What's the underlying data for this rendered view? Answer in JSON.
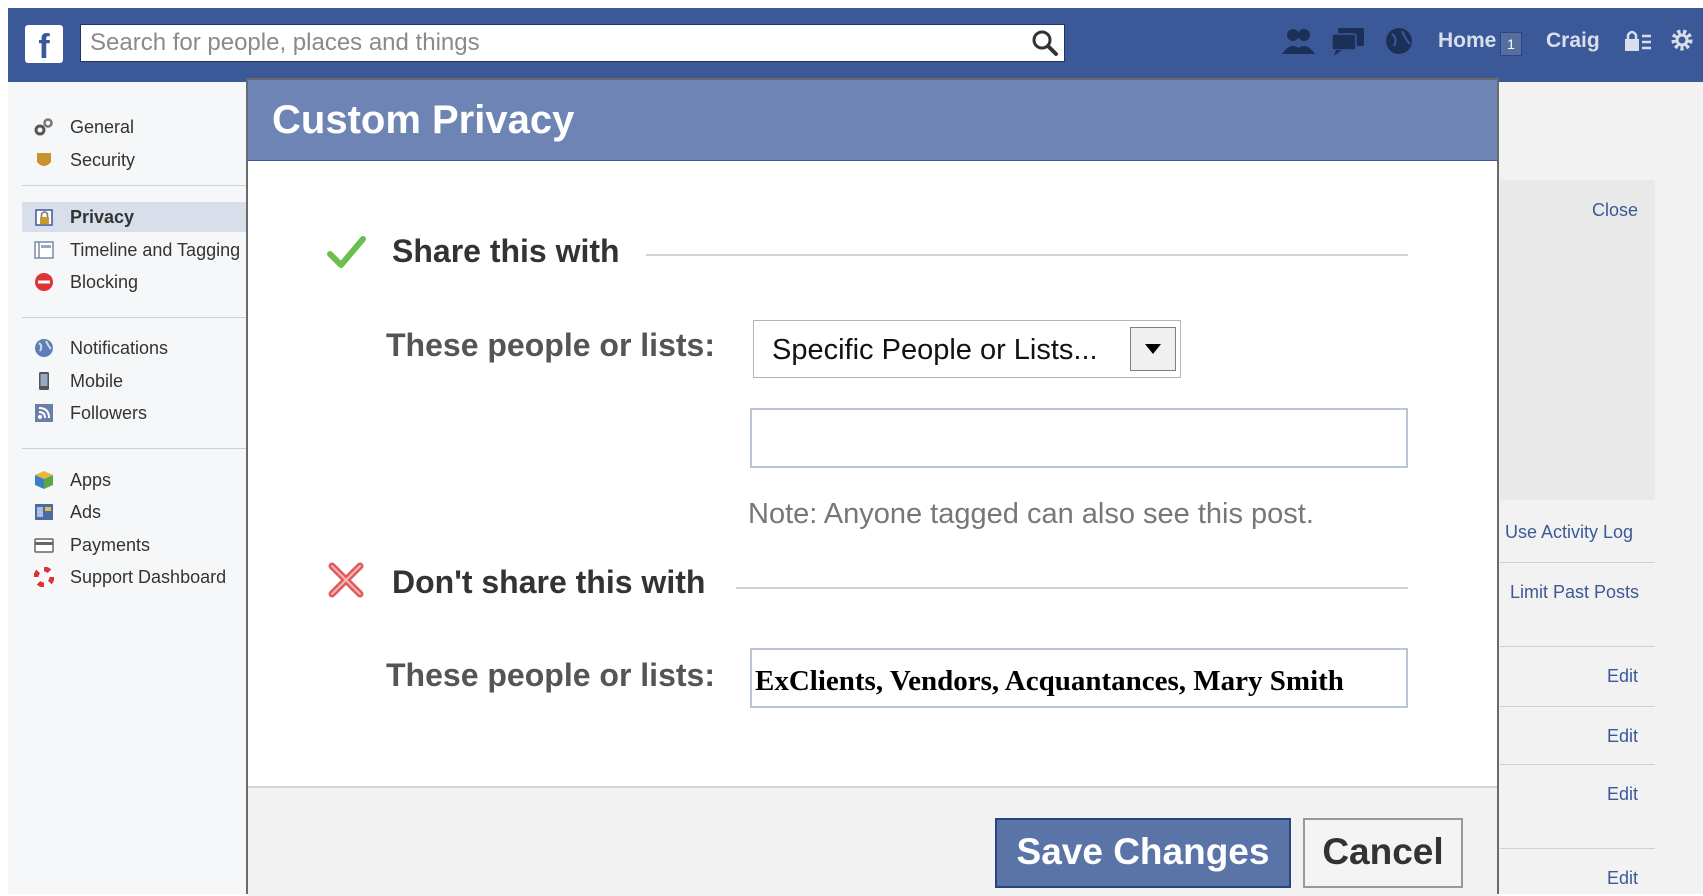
{
  "topbar": {
    "logo": "f",
    "search_placeholder": "Search for people, places and things",
    "home_label": "Home",
    "home_count": "1",
    "user_name": "Craig"
  },
  "sidebar": {
    "items": [
      {
        "label": "General",
        "icon": "gears-icon"
      },
      {
        "label": "Security",
        "icon": "badge-icon"
      },
      {
        "label": "Privacy",
        "icon": "lock-icon"
      },
      {
        "label": "Timeline and Tagging",
        "icon": "timeline-icon"
      },
      {
        "label": "Blocking",
        "icon": "blocked-icon"
      },
      {
        "label": "Notifications",
        "icon": "globe-icon"
      },
      {
        "label": "Mobile",
        "icon": "phone-icon"
      },
      {
        "label": "Followers",
        "icon": "rss-icon"
      },
      {
        "label": "Apps",
        "icon": "cube-icon"
      },
      {
        "label": "Ads",
        "icon": "ads-icon"
      },
      {
        "label": "Payments",
        "icon": "card-icon"
      },
      {
        "label": "Support Dashboard",
        "icon": "lifebuoy-icon"
      }
    ]
  },
  "background_panel": {
    "close": "Close",
    "activity_log": "Use Activity Log",
    "limit_posts": "Limit Past Posts",
    "edit": "Edit"
  },
  "dialog": {
    "title": "Custom Privacy",
    "share_section": "Share this with",
    "share_label": "These people or lists:",
    "share_select_value": "Specific People or Lists...",
    "share_input_value": "",
    "note": "Note: Anyone tagged can also see this post.",
    "except_section": "Don't share this with",
    "except_label": "These people or lists:",
    "except_value": "ExClients, Vendors, Acquantances, Mary Smith",
    "save_label": "Save Changes",
    "cancel_label": "Cancel"
  },
  "colors": {
    "brand": "#3b5998",
    "dialog_header": "#6d84b4",
    "check_green": "#6bbf4e",
    "cross_red": "#e05a5a"
  }
}
